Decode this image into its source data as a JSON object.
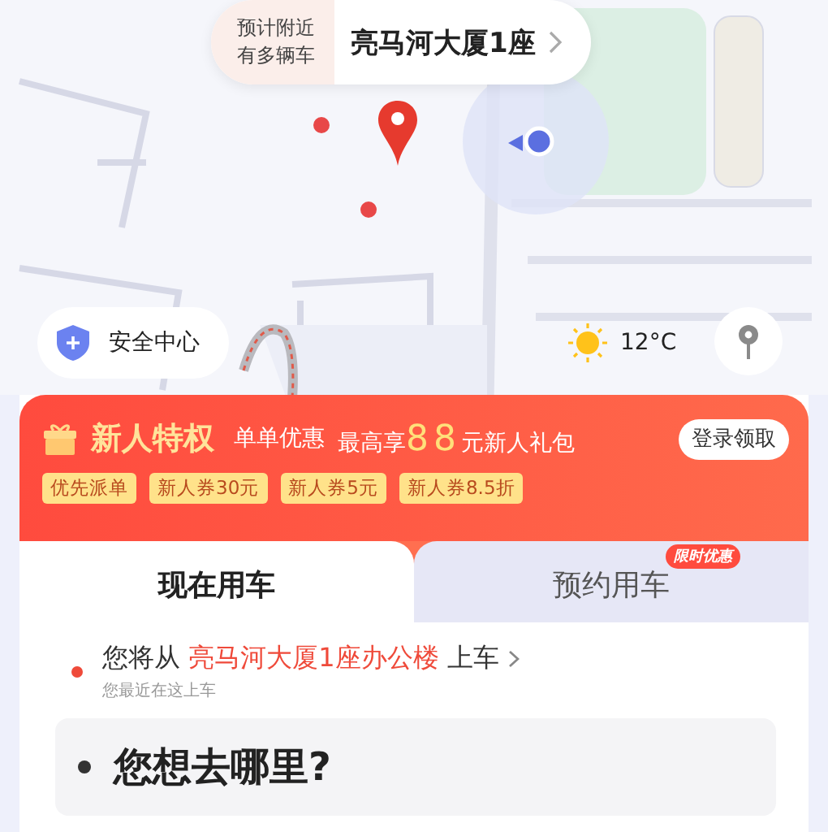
{
  "pickup_hint": {
    "note_lines": [
      "预计附近",
      "有多辆车"
    ],
    "place": "亮马河大厦1座"
  },
  "safety": {
    "label": "安全中心"
  },
  "weather": {
    "temperature": "12°C"
  },
  "promo": {
    "title": "新人特权",
    "subtitle": "单单优惠",
    "offer_prefix": "最高享",
    "amount": "88",
    "offer_suffix": "元新人礼包",
    "action": "登录领取",
    "tags": [
      "优先派单",
      "新人券30元",
      "新人券5元",
      "新人券8.5折"
    ]
  },
  "tabs": [
    {
      "label": "现在用车",
      "selected": true
    },
    {
      "label": "预约用车",
      "selected": false,
      "badge": "限时优惠"
    }
  ],
  "pickup": {
    "prefix": "您将从",
    "place": "亮马河大厦1座办公楼",
    "suffix": "上车",
    "note": "您最近在这上车"
  },
  "destination": {
    "prompt": "您想去哪里?"
  }
}
